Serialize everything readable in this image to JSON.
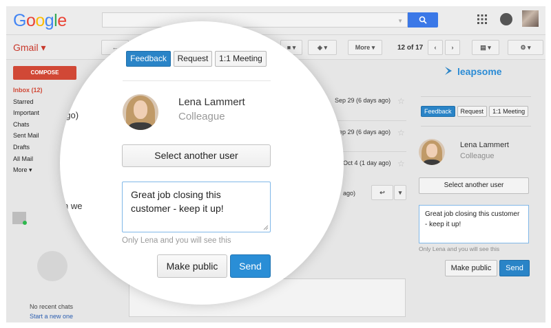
{
  "gmail": {
    "logo": "Google",
    "app_title": "Gmail",
    "compose_label": "COMPOSE",
    "nav": [
      "Inbox (12)",
      "Starred",
      "Important",
      "Chats",
      "Sent Mail",
      "Drafts",
      "All Mail",
      "More ▾"
    ],
    "more_label": "More ▾",
    "pager": "12 of 17",
    "dates": [
      "Sep 29 (6 days ago)",
      "Sep 29 (6 days ago)",
      "Oct 4 (1 day ago)",
      "ago)"
    ],
    "partial_left": "ago)",
    "partial_sender": "n we",
    "no_chats": "No recent chats",
    "start_new": "Start a new one"
  },
  "leapsome": {
    "logo": "leapsome",
    "tabs": [
      "Feedback",
      "Request",
      "1:1 Meeting"
    ],
    "active_tab": "Feedback",
    "user_name": "Lena Lammert",
    "user_role": "Colleague",
    "select_user_label": "Select another user",
    "feedback_text": "Great job closing this customer - keep it up!",
    "privacy_hint": "Only Lena and you will see this",
    "make_public_label": "Make public",
    "send_label": "Send"
  },
  "colors": {
    "accent_blue": "#2a84c7",
    "gmail_red": "#d14836",
    "search_blue": "#3b78e7"
  }
}
